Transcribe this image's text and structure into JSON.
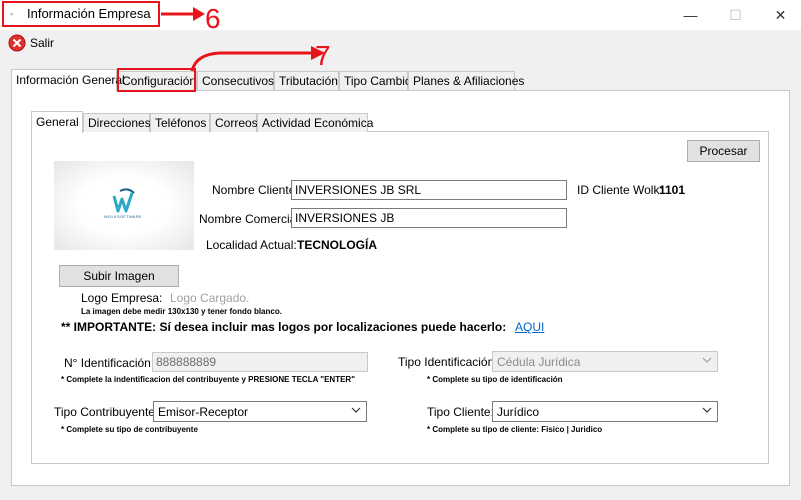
{
  "window": {
    "title": "Información Empresa",
    "minimize_glyph": "—",
    "maximize_glyph": "☐",
    "close_glyph": "✕"
  },
  "toolbar": {
    "exit_label": "Salir"
  },
  "annotations": {
    "first": "6",
    "second": "7",
    "color": "#e8141c"
  },
  "main_tabs": [
    "Información General",
    "Configuración",
    "Consecutivos",
    "Tributación",
    "Tipo Cambio",
    "Planes & Afiliaciones"
  ],
  "sub_tabs": [
    "General",
    "Direcciones",
    "Teléfonos",
    "Correos",
    "Actividad Económica"
  ],
  "actions": {
    "process_label": "Procesar",
    "upload_label": "Subir Imagen"
  },
  "client": {
    "name_label": "Nombre Cliente:",
    "name_value": "INVERSIONES JB SRL",
    "trade_label": "Nombre Comercial:",
    "trade_value": "INVERSIONES JB",
    "locality_label": "Localidad Actual:",
    "locality_value": "TECNOLOGÍA",
    "id_label": "ID Cliente Wolk:",
    "id_value": "1101"
  },
  "logo": {
    "label": "Logo Empresa:",
    "status": "Logo Cargado.",
    "hint": "La imagen debe medir 130x130 y tener fondo blanco.",
    "important": "** IMPORTANTE: Sí desea incluir mas logos por localizaciones puede hacerlo:",
    "link": "AQUI",
    "brand_text": "WOLKSOFTWARE"
  },
  "identification": {
    "label": "N° Identificación:",
    "value": "888888889",
    "hint": "* Complete la indentificacion del contribuyente y PRESIONE TECLA \"ENTER\"",
    "type_label": "Tipo Identificación:",
    "type_value": "Cédula Jurídica",
    "type_hint": "* Complete su tipo de identificación"
  },
  "taxpayer": {
    "label": "Tipo Contribuyente:",
    "value": "Emisor-Receptor",
    "hint": "* Complete su tipo de contribuyente",
    "client_type_label": "Tipo Cliente:",
    "client_type_value": "Jurídico",
    "client_type_hint": "* Complete su tipo de cliente: Fisico | Juridico"
  }
}
